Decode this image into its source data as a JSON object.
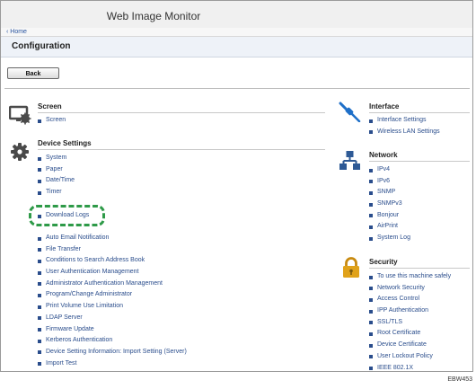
{
  "app": {
    "title": "Web Image Monitor"
  },
  "breadcrumb": "‹ Home",
  "page": {
    "title": "Configuration"
  },
  "buttons": {
    "back": "Back"
  },
  "left": {
    "screen": {
      "title": "Screen",
      "icon": "monitor-gear-icon",
      "items": [
        "Screen"
      ]
    },
    "device": {
      "title": "Device Settings",
      "icon": "gear-icon",
      "items_a": [
        "System",
        "Paper",
        "Date/Time",
        "Timer"
      ],
      "highlighted": "Download Logs",
      "items_b": [
        "Auto Email Notification",
        "File Transfer",
        "Conditions to Search Address Book",
        "User Authentication Management",
        "Administrator Authentication Management",
        "Program/Change Administrator",
        "Print Volume Use Limitation",
        "LDAP Server",
        "Firmware Update",
        "Kerberos Authentication",
        "Device Setting Information: Import Setting (Server)",
        "Import Test"
      ]
    }
  },
  "right": {
    "interface": {
      "title": "Interface",
      "icon": "cable-icon",
      "items": [
        "Interface Settings",
        "Wireless LAN Settings"
      ]
    },
    "network": {
      "title": "Network",
      "icon": "network-icon",
      "items": [
        "IPv4",
        "IPv6",
        "SNMP",
        "SNMPv3",
        "Bonjour",
        "AirPrint",
        "System Log"
      ]
    },
    "security": {
      "title": "Security",
      "icon": "padlock-icon",
      "items": [
        "To use this machine safely",
        "Network Security",
        "Access Control",
        "IPP Authentication",
        "SSL/TLS",
        "Root Certificate",
        "Device Certificate",
        "User Lockout Policy",
        "IEEE 802.1X"
      ]
    }
  },
  "figure_id": "EBW453",
  "colors": {
    "link": "#2a4d8c",
    "highlight": "#2e9a48",
    "icon_gray": "#4a4a4a",
    "cable_blue": "#1e6fc8",
    "lock_gold": "#e0a21a"
  }
}
